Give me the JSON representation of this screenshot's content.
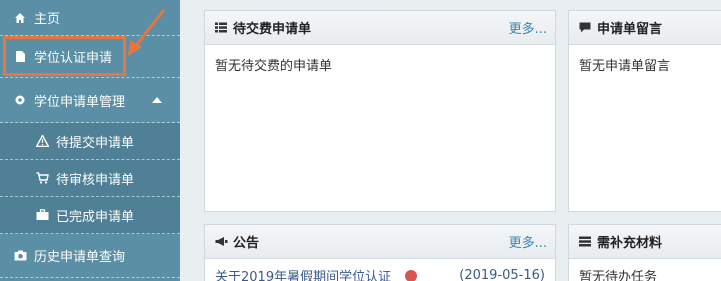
{
  "sidebar": {
    "items": [
      {
        "label": "主页",
        "icon": "home-icon"
      },
      {
        "label": "学位认证申请",
        "icon": "file-icon"
      },
      {
        "label": "学位申请单管理",
        "icon": "gear-icon"
      },
      {
        "label": "待提交申请单",
        "icon": "warning-icon"
      },
      {
        "label": "待审核申请单",
        "icon": "cart-icon"
      },
      {
        "label": "已完成申请单",
        "icon": "briefcase-icon"
      },
      {
        "label": "历史申请单查询",
        "icon": "camera-icon"
      }
    ]
  },
  "panels": {
    "pending_payment": {
      "title": "待交费申请单",
      "more": "更多...",
      "empty": "暂无待交费的申请单"
    },
    "messages": {
      "title": "申请单留言",
      "empty": "暂无申请单留言"
    },
    "notice": {
      "title": "公告",
      "more": "更多...",
      "row_title": "关于2019年暑假期间学位认证",
      "row_date": "(2019-05-16)"
    },
    "materials": {
      "title": "需补充材料",
      "empty": "暂无待办任务"
    }
  },
  "colors": {
    "sidebar": "#5b8fa5",
    "highlight": "#e8743f",
    "link": "#3a87ad"
  }
}
